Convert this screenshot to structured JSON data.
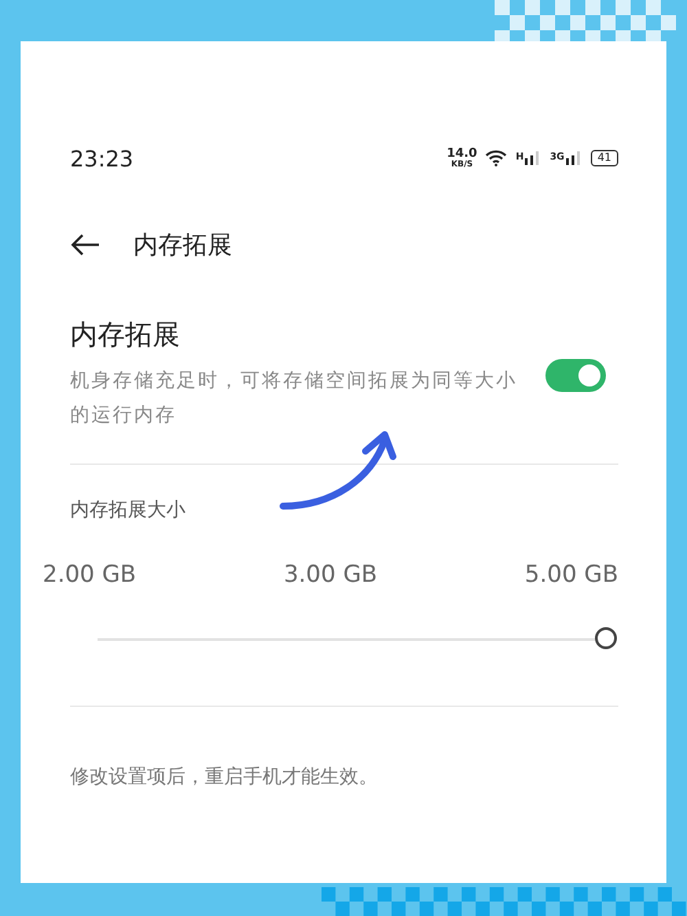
{
  "status_bar": {
    "time": "23:23",
    "speed": "14.0",
    "speed_unit": "KB/S",
    "network_1": "H",
    "network_2": "3G",
    "battery": "41"
  },
  "header": {
    "title": "内存拓展"
  },
  "setting": {
    "title": "内存拓展",
    "description": "机身存储充足时，可将存储空间拓展为同等大小的运行内存",
    "on": true
  },
  "size_section": {
    "label": "内存拓展大小",
    "ticks": [
      "2.00 GB",
      "3.00 GB",
      "5.00 GB"
    ],
    "level": 1
  },
  "footer": {
    "note": "修改设置项后，重启手机才能生效。"
  }
}
